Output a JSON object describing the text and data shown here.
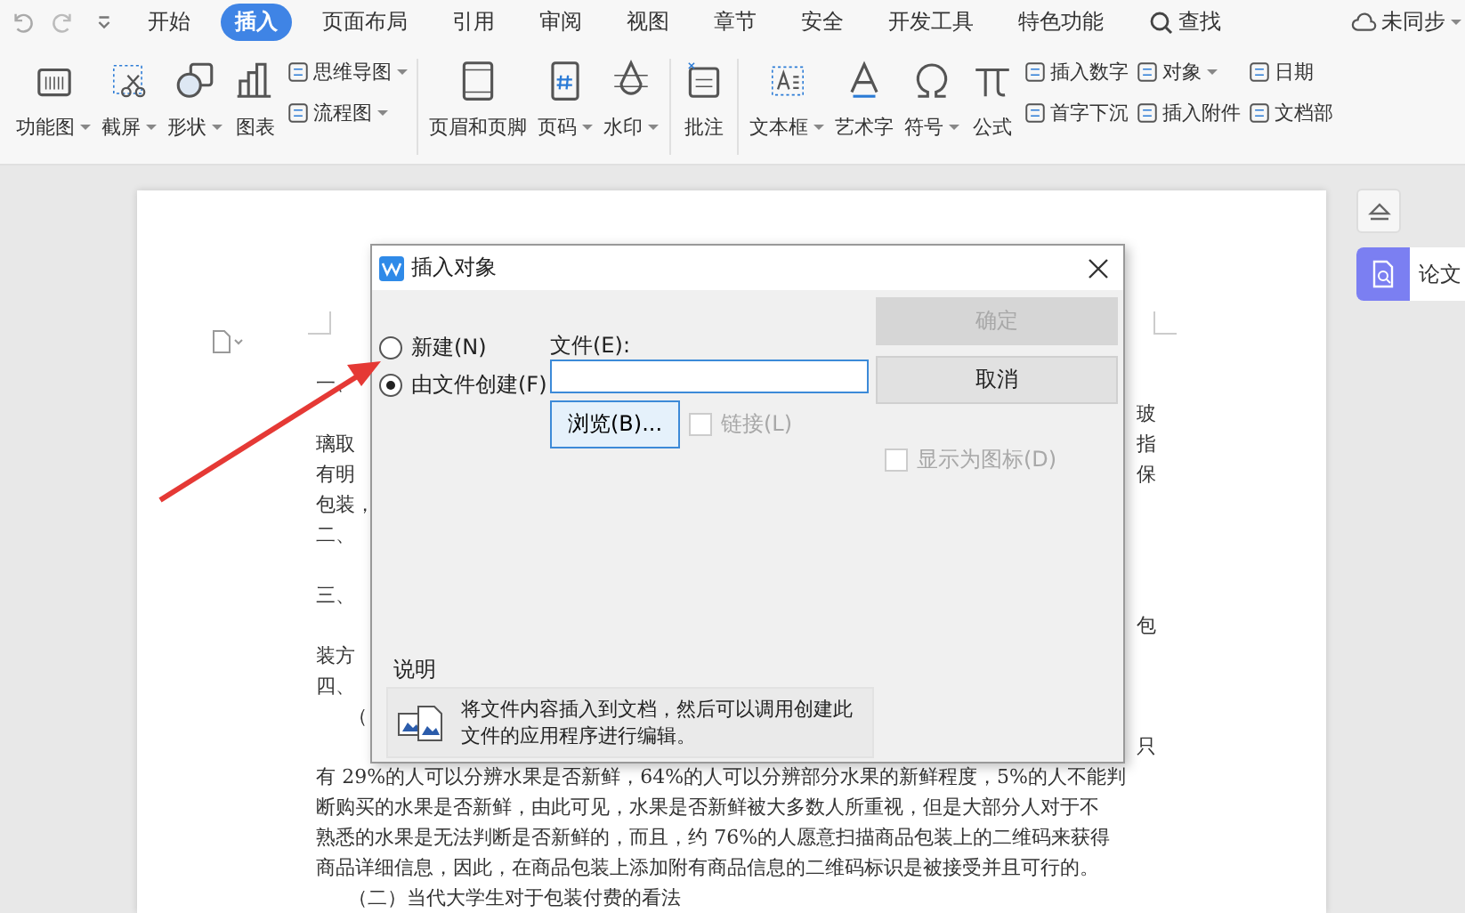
{
  "menu_tabs": [
    {
      "label": "开始",
      "selected": false
    },
    {
      "label": "插入",
      "selected": true
    },
    {
      "label": "页面布局",
      "selected": false
    },
    {
      "label": "引用",
      "selected": false
    },
    {
      "label": "审阅",
      "selected": false
    },
    {
      "label": "视图",
      "selected": false
    },
    {
      "label": "章节",
      "selected": false
    },
    {
      "label": "安全",
      "selected": false
    },
    {
      "label": "开发工具",
      "selected": false
    },
    {
      "label": "特色功能",
      "selected": false
    }
  ],
  "search": {
    "label": "查找"
  },
  "sync_status": {
    "label": "未同步"
  },
  "toolbar": [
    {
      "items": [
        {
          "kind": "large",
          "label": "功能图",
          "dropdown": true
        },
        {
          "kind": "large",
          "label": "截屏",
          "dropdown": true
        },
        {
          "kind": "large",
          "label": "形状",
          "dropdown": true
        },
        {
          "kind": "large",
          "label": "图表",
          "dropdown": false
        },
        {
          "kind": "stack",
          "entries": [
            {
              "label": "思维导图",
              "dropdown": true
            },
            {
              "label": "流程图",
              "dropdown": true
            }
          ]
        }
      ]
    },
    {
      "items": [
        {
          "kind": "large",
          "label": "页眉和页脚",
          "dropdown": false
        },
        {
          "kind": "large",
          "label": "页码",
          "dropdown": true
        },
        {
          "kind": "large",
          "label": "水印",
          "dropdown": true
        }
      ]
    },
    {
      "items": [
        {
          "kind": "large",
          "label": "批注",
          "dropdown": false
        }
      ]
    },
    {
      "items": [
        {
          "kind": "large",
          "label": "文本框",
          "dropdown": true
        },
        {
          "kind": "large",
          "label": "艺术字",
          "dropdown": false
        },
        {
          "kind": "large",
          "label": "符号",
          "dropdown": true
        },
        {
          "kind": "large",
          "label": "公式",
          "dropdown": false
        },
        {
          "kind": "stack",
          "entries": [
            {
              "label": "插入数字",
              "dropdown": false
            },
            {
              "label": "首字下沉",
              "dropdown": false
            }
          ]
        },
        {
          "kind": "stack",
          "entries": [
            {
              "label": "对象",
              "dropdown": true
            },
            {
              "label": "插入附件",
              "dropdown": false
            }
          ]
        },
        {
          "kind": "stack",
          "entries": [
            {
              "label": "日期",
              "dropdown": false
            },
            {
              "label": "文档部",
              "dropdown": false
            }
          ]
        }
      ]
    }
  ],
  "document": {
    "lines": [
      {
        "left": "一、",
        "indent": false
      },
      {
        "right": "玻"
      },
      {
        "left": "璃取",
        "right": "指",
        "indent": false
      },
      {
        "left": "有明",
        "right": "保",
        "indent": false
      },
      {
        "left": "包装，",
        "indent": false
      },
      {
        "left": "二、",
        "indent": false
      },
      {
        "kind": "covered"
      },
      {
        "left": "三、",
        "indent": false
      },
      {
        "right": "包"
      },
      {
        "left": "装方",
        "indent": false
      },
      {
        "left": "四、",
        "indent": false
      },
      {
        "left": "（",
        "indent": true
      },
      {
        "right": "只"
      },
      {
        "left": "有 29%的人可以分辨水果是否新鲜，64%的人可以分辨部分水果的新鲜程度，5%的人不能判",
        "indent": false
      },
      {
        "left": "断购买的水果是否新鲜，由此可见，水果是否新鲜被大多数人所重视，但是大部分人对于不",
        "indent": false
      },
      {
        "left": "熟悉的水果是无法判断是否新鲜的，而且，约 76%的人愿意扫描商品包装上的二维码来获得",
        "indent": false
      },
      {
        "left": "商品详细信息，因此，在商品包装上添加附有商品信息的二维码标识是被接受并且可行的。",
        "indent": false
      },
      {
        "left": "（二）当代大学生对于包装付费的看法",
        "indent": true
      }
    ]
  },
  "side_panel": {
    "tab_label": "论文"
  },
  "dialog": {
    "title": "插入对象",
    "options": [
      {
        "label": "新建(N)",
        "selected": false
      },
      {
        "label": "由文件创建(F)",
        "selected": true
      }
    ],
    "file_label": "文件(E):",
    "browse_button": "浏览(B)...",
    "link_checkbox": {
      "label": "链接(L)",
      "checked": false,
      "disabled": true
    },
    "ok_button": {
      "label": "确定",
      "disabled": true
    },
    "cancel_button": {
      "label": "取消",
      "disabled": false
    },
    "icon_checkbox": {
      "label": "显示为图标(D)",
      "checked": false,
      "disabled": true
    },
    "description_title": "说明",
    "description": "将文件内容插入到文档，然后可以调用创建此文件的应用程序进行编辑。"
  }
}
